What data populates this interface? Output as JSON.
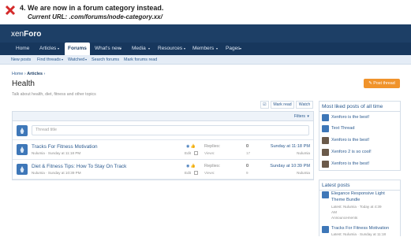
{
  "annotation": {
    "line1": "4. We are now in a forum category instead.",
    "line2": "Current URL: .com/forums/node-category.xx/"
  },
  "logo": {
    "a": "xen",
    "b": "Foro"
  },
  "nav": [
    "Home",
    "Articles",
    "Forums",
    "What's new",
    "Media",
    "Resources",
    "Members",
    "Pages"
  ],
  "subnav": [
    "New posts",
    "Find threads",
    "Watched",
    "Search forums",
    "Mark forums read"
  ],
  "breadcrumb": {
    "home": "Home",
    "articles": "Articles"
  },
  "page": {
    "title": "Health",
    "description": "Talk about health, diet, fitness and other topics",
    "post_thread": "Post thread"
  },
  "actions": {
    "mark_read": "Mark read",
    "watch": "Watch"
  },
  "filters_label": "Filters",
  "thread_title_placeholder": "Thread title",
  "threads": [
    {
      "title": "Tracks For Fitness Motivation",
      "meta": "Nulumia · Sunday at 11:18 PM",
      "edit": "Edit",
      "replies_label": "Replies:",
      "replies": "0",
      "views_label": "Views:",
      "views": "17",
      "last_date": "Sunday at 11:18 PM",
      "last_user": "Nulumia"
    },
    {
      "title": "Diet & Fitness Tips: How To Stay On Track",
      "meta": "Nulumia · Sunday at 10:39 PM",
      "edit": "Edit",
      "replies_label": "Replies:",
      "replies": "0",
      "views_label": "Views:",
      "views": "9",
      "last_date": "Sunday at 10:39 PM",
      "last_user": "Nulumia"
    }
  ],
  "most_liked": {
    "title": "Most liked posts of all time",
    "items": [
      "Xenforo is the best!",
      "Text Thread",
      "Xenforo is the best!",
      "Xenforo 2 is so cool!",
      "Xenforo is the best!"
    ]
  },
  "latest_posts": {
    "title": "Latest posts",
    "items": [
      {
        "line1": "Elegance Responsive Light",
        "line2": "Theme Bundle",
        "line3": "Latest: Nulumia · Today at 4:39",
        "line4": "AM",
        "line5": "Announcements"
      },
      {
        "line1": "Tracks For Fitness Motivation",
        "line2": "Latest: Nulumia · Sunday at 11:18"
      }
    ]
  },
  "colors": {
    "header": "#1d3f66",
    "nav": "#17375d",
    "accent": "#f0932b",
    "link": "#2b5a8f"
  }
}
